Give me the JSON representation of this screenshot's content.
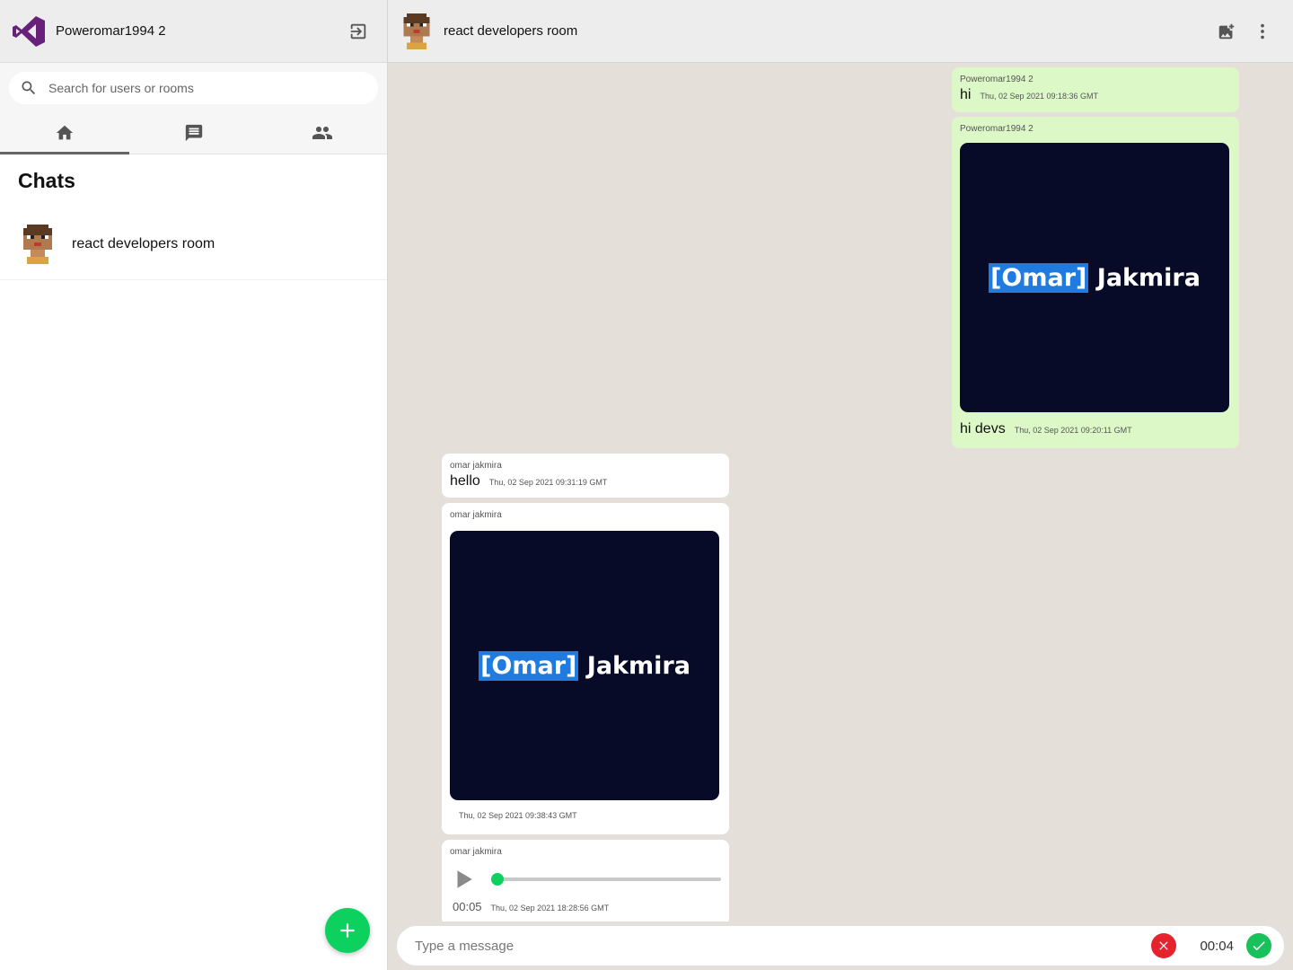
{
  "sidebar": {
    "username": "Poweromar1994 2",
    "search_placeholder": "Search for users or rooms",
    "tabs": [
      {
        "icon": "home-icon",
        "active": true
      },
      {
        "icon": "chat-icon",
        "active": false
      },
      {
        "icon": "people-icon",
        "active": false
      }
    ],
    "section_title": "Chats",
    "chats": [
      {
        "name": "react developers room"
      }
    ]
  },
  "room": {
    "name": "react developers room"
  },
  "messages": [
    {
      "sender": "Poweromar1994 2",
      "text": "hi",
      "time": "Thu, 02 Sep 2021 09:18:36 GMT",
      "mine": true
    },
    {
      "sender": "Poweromar1994 2",
      "image_text_hl": "[Omar]",
      "image_text": "Jakmira",
      "caption": "hi devs",
      "time": "Thu, 02 Sep 2021 09:20:11 GMT",
      "mine": true
    },
    {
      "sender": "omar jakmira",
      "text": "hello",
      "time": "Thu, 02 Sep 2021 09:31:19 GMT",
      "mine": false
    },
    {
      "sender": "omar jakmira",
      "image_text_hl": "[Omar]",
      "image_text": "Jakmira",
      "time": "Thu, 02 Sep 2021 09:38:43 GMT",
      "mine": false
    },
    {
      "sender": "omar jakmira",
      "audio_duration": "00:05",
      "time": "Thu, 02 Sep 2021 18:28:56 GMT",
      "mine": false
    }
  ],
  "composer": {
    "placeholder": "Type a message",
    "recording_time": "00:04"
  },
  "colors": {
    "accent_green": "#0dd15f",
    "own_bubble": "#dcf8c6",
    "chat_background": "#e4dfd8",
    "logo_purple": "#68217a"
  }
}
